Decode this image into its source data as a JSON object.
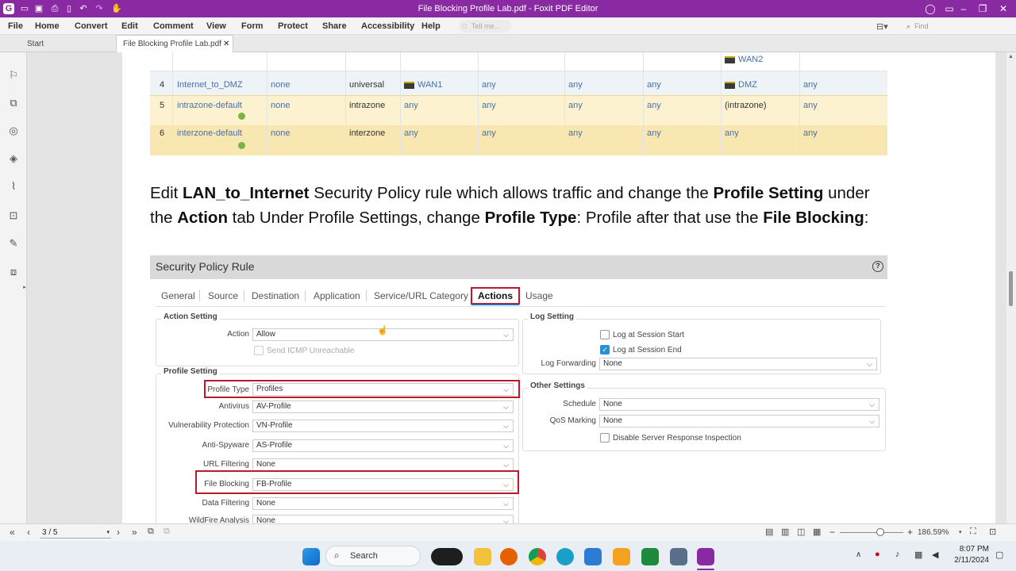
{
  "window": {
    "title": "File Blocking Profile Lab.pdf - Foxit PDF Editor"
  },
  "menu": [
    "File",
    "Home",
    "Convert",
    "Edit",
    "Comment",
    "View",
    "Form",
    "Protect",
    "Share",
    "Accessibility",
    "Help"
  ],
  "tellme": "Tell me...",
  "find": "Find",
  "tabs": {
    "start": "Start",
    "doc": "File Blocking Profile Lab.pdf",
    "close": "✕"
  },
  "table": {
    "rows": [
      {
        "num": "",
        "name": "",
        "type": "",
        "src": "",
        "srcaddr": "",
        "user": "",
        "hip": "",
        "dst": "WAN2",
        "dstaddr": ""
      },
      {
        "num": "4",
        "name": "Internet_to_DMZ",
        "tags": "none",
        "type": "universal",
        "src": "WAN1",
        "srcaddr": "any",
        "user": "any",
        "hip": "any",
        "dst": "DMZ",
        "dstaddr": "any"
      },
      {
        "num": "5",
        "name": "intrazone-default",
        "tags": "none",
        "type": "intrazone",
        "src": "any",
        "srcaddr": "any",
        "user": "any",
        "hip": "any",
        "dst": "(intrazone)",
        "dstaddr": "any"
      },
      {
        "num": "6",
        "name": "interzone-default",
        "tags": "none",
        "type": "interzone",
        "src": "any",
        "srcaddr": "any",
        "user": "any",
        "hip": "any",
        "dst": "any",
        "dstaddr": "any"
      }
    ]
  },
  "para": {
    "p1": "Edit ",
    "b1": "LAN_to_Internet",
    "p2": " Security Policy rule which allows traffic and change the ",
    "b2": "Profile Setting",
    "p3": " under the ",
    "b3": "Action",
    "p4": " tab Under Profile Settings, change ",
    "b4": "Profile Type",
    "p5": ": Profile after that use the ",
    "b5": "File Blocking",
    "p6": ":"
  },
  "panel": {
    "title": "Security Policy Rule",
    "help": "?",
    "tabs": [
      "General",
      "Source",
      "Destination",
      "Application",
      "Service/URL Category",
      "Actions",
      "Usage"
    ],
    "action_setting": "Action Setting",
    "action_label": "Action",
    "action_value": "Allow",
    "send_icmp": "Send ICMP Unreachable",
    "profile_setting": "Profile Setting",
    "profile_rows": [
      {
        "label": "Profile Type",
        "value": "Profiles"
      },
      {
        "label": "Antivirus",
        "value": "AV-Profile"
      },
      {
        "label": "Vulnerability Protection",
        "value": "VN-Profile"
      },
      {
        "label": "Anti-Spyware",
        "value": "AS-Profile"
      },
      {
        "label": "URL Filtering",
        "value": "None"
      },
      {
        "label": "File Blocking",
        "value": "FB-Profile"
      },
      {
        "label": "Data Filtering",
        "value": "None"
      },
      {
        "label": "WildFire Analysis",
        "value": "None"
      }
    ],
    "log_setting": "Log Setting",
    "log_start": "Log at Session Start",
    "log_end": "Log at Session End",
    "log_fwd_label": "Log Forwarding",
    "log_fwd_value": "None",
    "other_settings": "Other Settings",
    "schedule_label": "Schedule",
    "schedule_value": "None",
    "qos_label": "QoS Marking",
    "qos_value": "None",
    "disable_sri": "Disable Server Response Inspection"
  },
  "bottom": {
    "page": "3 / 5",
    "zoom": "186.59%"
  },
  "taskbar": {
    "search": "Search",
    "time": "8:07 PM",
    "date": "2/11/2024"
  }
}
